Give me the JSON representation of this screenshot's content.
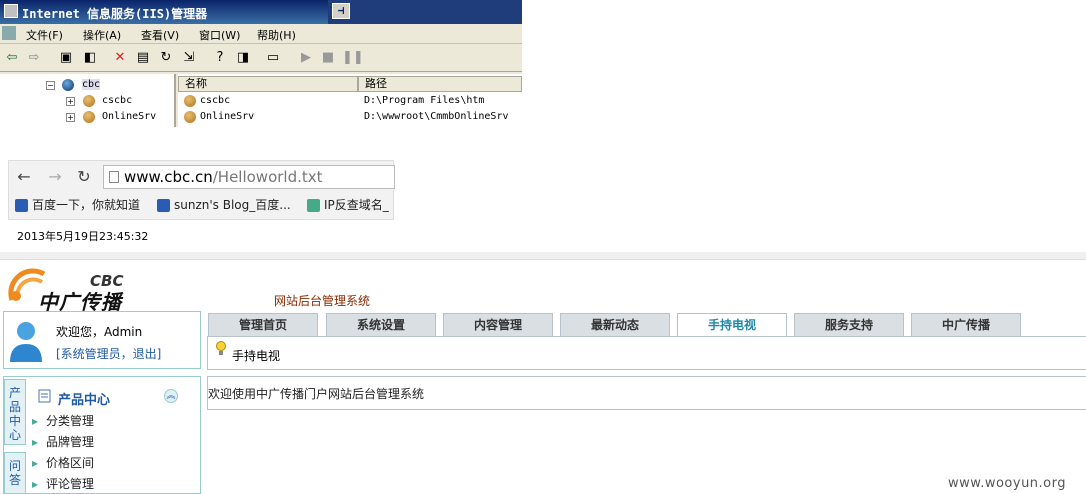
{
  "iis": {
    "title": "Internet 信息服务(IIS)管理器",
    "menu": [
      "文件(F)",
      "操作(A)",
      "查看(V)",
      "窗口(W)",
      "帮助(H)"
    ],
    "tree": [
      "cbc",
      "cscbc",
      "OnlineSrv"
    ],
    "columns": [
      "名称",
      "路径"
    ],
    "rows": [
      {
        "name": "cscbc",
        "path": "D:\\Program Files\\htm"
      },
      {
        "name": "OnlineSrv",
        "path": "D:\\wwwroot\\CmmbOnlineSrv"
      }
    ]
  },
  "browser": {
    "url_domain": "www.cbc.cn",
    "url_path": "/Helloworld.txt",
    "bookmarks": [
      "百度一下，你就知道",
      "sunzn's Blog_百度...",
      "IP反查域名_"
    ],
    "page_text": "2013年5月19日23:45:32"
  },
  "cms": {
    "logo_en": "CBC",
    "logo_cn": "中广传播",
    "subtitle": "网站后台管理系统",
    "welcome": "欢迎您，Admin",
    "roles": "[系统管理员，退出]",
    "tabs": [
      "管理首页",
      "系统设置",
      "内容管理",
      "最新动态",
      "手持电视",
      "服务支持",
      "中广传播"
    ],
    "active_tab": "手持电视",
    "crumb": "手持电视",
    "main_text": "欢迎使用中广传播门户网站后台管理系统",
    "side_tabs": [
      "产品中心",
      "问答"
    ],
    "section_title": "产品中心",
    "side_items": [
      "分类管理",
      "品牌管理",
      "价格区间",
      "评论管理"
    ]
  },
  "watermark": "www.wooyun.org",
  "colors": {
    "accent": "#1e88a8",
    "title_bar": "#0a246a",
    "link": "#1f5aa6"
  }
}
